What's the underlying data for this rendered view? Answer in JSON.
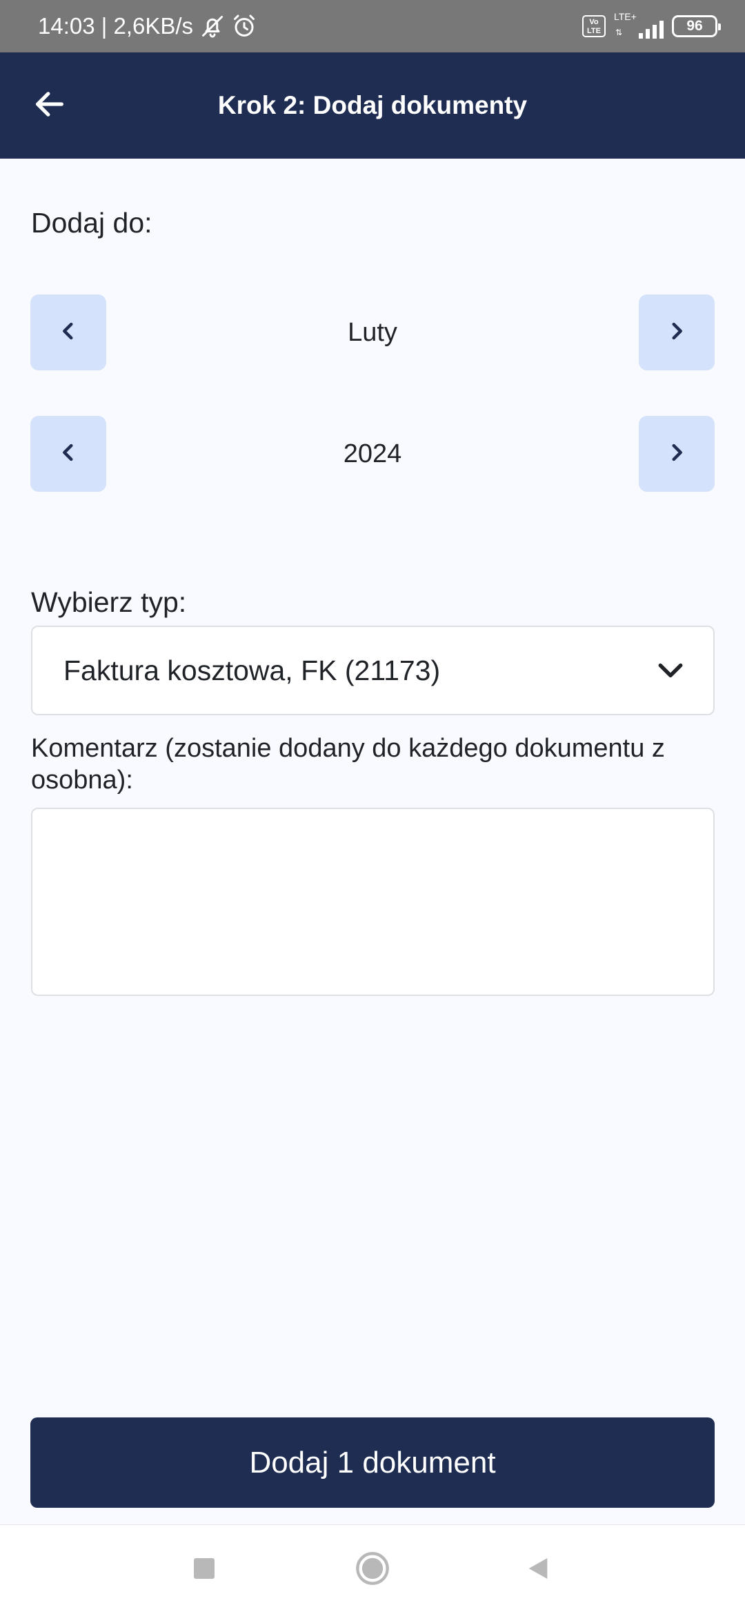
{
  "status_bar": {
    "time_speed": "14:03 | 2,6KB/s",
    "volte": "Vo LTE",
    "network": "LTE+",
    "battery": "96"
  },
  "app_bar": {
    "title": "Krok 2: Dodaj dokumenty",
    "back_icon": "arrow-left-icon"
  },
  "form": {
    "add_to_label": "Dodaj do:",
    "month": {
      "value": "Luty",
      "prev_icon": "chevron-left-icon",
      "next_icon": "chevron-right-icon"
    },
    "year": {
      "value": "2024",
      "prev_icon": "chevron-left-icon",
      "next_icon": "chevron-right-icon"
    },
    "type_label": "Wybierz typ:",
    "type_value": "Faktura kosztowa, FK (21173)",
    "comment_label": "Komentarz (zostanie dodany do każdego dokumentu z osobna):",
    "comment_value": ""
  },
  "actions": {
    "submit_label": "Dodaj 1 dokument"
  },
  "colors": {
    "primary": "#1f2d52",
    "stepper_bg": "#d5e2fb",
    "page_bg": "#f8faff",
    "status_bg": "#787878"
  },
  "nav_bar": {
    "icons": [
      "recent-apps-icon",
      "home-icon",
      "back-triangle-icon"
    ]
  }
}
